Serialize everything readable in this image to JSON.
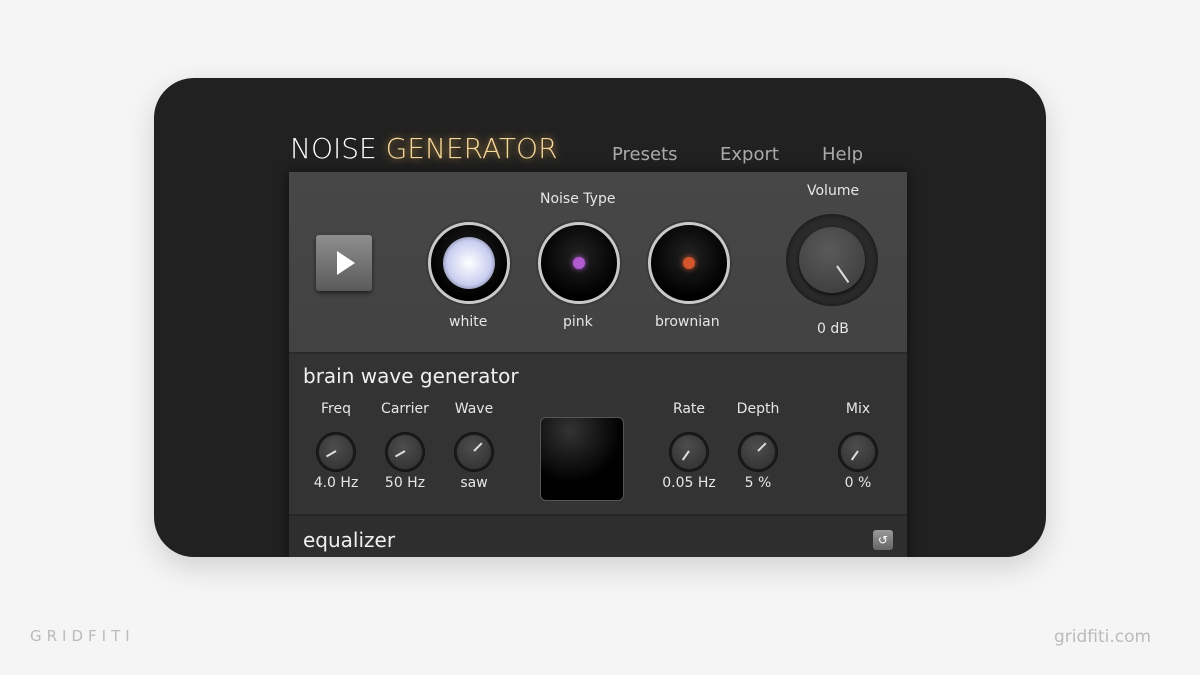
{
  "app": {
    "title_part1": "NOISE ",
    "title_part2": "GENERATOR"
  },
  "nav": [
    {
      "label": "Presets"
    },
    {
      "label": "Export"
    },
    {
      "label": "Help"
    }
  ],
  "noise": {
    "heading": "Noise Type",
    "types": [
      {
        "label": "white",
        "color": "#dfe4ff"
      },
      {
        "label": "pink",
        "color": "#b05bd0"
      },
      {
        "label": "brownian",
        "color": "#d2552e"
      }
    ],
    "play_icon": "play-icon"
  },
  "volume": {
    "label": "Volume",
    "value": "0 dB"
  },
  "brainwave": {
    "title": "brain wave generator",
    "controls": [
      {
        "label": "Freq",
        "value": "4.0 Hz",
        "angle": -120
      },
      {
        "label": "Carrier",
        "value": "50 Hz",
        "angle": -120
      },
      {
        "label": "Wave",
        "value": "saw",
        "angle": -140
      },
      {
        "label": "Rate",
        "value": "0.05 Hz",
        "angle": -150
      },
      {
        "label": "Depth",
        "value": "5 %",
        "angle": -135
      },
      {
        "label": "Mix",
        "value": "0 %",
        "angle": -150
      }
    ]
  },
  "equalizer": {
    "title": "equalizer",
    "reset_icon": "reset-icon",
    "reset_glyph": "↺"
  },
  "footer": {
    "left": "GRIDFITI",
    "right": "gridfiti.com"
  }
}
